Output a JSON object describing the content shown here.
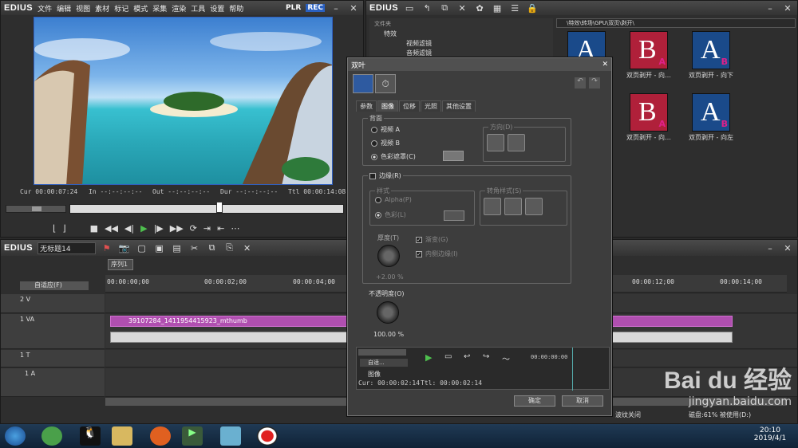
{
  "player": {
    "logo": "EDIUS",
    "menu": [
      "文件",
      "编辑",
      "视图",
      "素材",
      "标记",
      "模式",
      "采集",
      "渲染",
      "工具",
      "设置",
      "帮助"
    ],
    "plr": "PLR",
    "rec": "REC",
    "cur": "Cur 00:00:07:24",
    "in": "In --:--:--:--",
    "out": "Out --:--:--:--",
    "dur": "Dur --:--:--:--",
    "ttl": "Ttl 00:00:14:08"
  },
  "library": {
    "logo": "EDIUS",
    "tree_header": "文件夹",
    "tree": [
      "特效",
      "视频滤镜",
      "音频滤镜"
    ],
    "path": "\\特效\\转场\\GPU\\双页\\剥开\\",
    "items": [
      {
        "label": "",
        "letter": "A",
        "sub": "",
        "bg": "#1a4a8a",
        "fg": "#fff"
      },
      {
        "label": "双页剥开 - 向…",
        "letter": "B",
        "sub": "A",
        "bg": "#b0203a",
        "fg": "#fff"
      },
      {
        "label": "双页剥开 - 向下",
        "letter": "A",
        "sub": "B",
        "bg": "#1a4a8a",
        "fg": "#fff"
      },
      {
        "label": "双页剥开 - 向…",
        "letter": "B",
        "sub": "A",
        "bg": "#b0203a",
        "fg": "#fff"
      },
      {
        "label": "双页剥开 - 向左",
        "letter": "A",
        "sub": "B",
        "bg": "#1a4a8a",
        "fg": "#fff"
      }
    ]
  },
  "timeline": {
    "logo": "EDIUS",
    "project": "无标题14",
    "sequence_tab": "序列1",
    "autoscroll": "自适应(F)",
    "ruler": [
      "00:00:00;00",
      "00:00:02;00",
      "00:00:04;00",
      "00:00:12;00",
      "00:00:14;00"
    ],
    "tracks": [
      {
        "name": "2 V"
      },
      {
        "name": "1 VA"
      },
      {
        "name": "1 T"
      },
      {
        "name": "1 A"
      }
    ],
    "clip_name": "39107284_1411954415923_mthumb",
    "status_left": "波纹关闭",
    "status_right": "磁盘:61% 被使用(D:)"
  },
  "dialog": {
    "title": "双叶",
    "tabs": [
      "参数",
      "图像",
      "位移",
      "光照",
      "其他设置"
    ],
    "group_back": "背面",
    "opt_video_a": "视频 A",
    "opt_video_b": "视频 B",
    "opt_color": "色彩遮罩(C)",
    "group_dir": "方向(D)",
    "border_check": "边缘(R)",
    "group_style": "样式",
    "opt_alpha": "Alpha(P)",
    "opt_colorb": "色彩(L)",
    "group_corner": "转角样式(S)",
    "thickness": "厚度(T)",
    "gradient": "渐变(G)",
    "inner_edge": "内侧边缘(I)",
    "thickness_val": "+2.00 %",
    "opacity": "不透明度(O)",
    "opacity_val": "100.00 %",
    "mini_auto": "自适...",
    "mini_track": "图像",
    "mini_cur": "Cur: 00:00:02:14",
    "mini_ttl": "Ttl: 00:00:02:14",
    "mini_ruler": "00:00:00:00",
    "ok": "确定",
    "cancel": "取消"
  },
  "taskbar": {
    "time": "20:10",
    "date": "2019/4/1"
  },
  "watermark": {
    "brand": "Bai du 经验",
    "url": "jingyan.baidu.com"
  }
}
